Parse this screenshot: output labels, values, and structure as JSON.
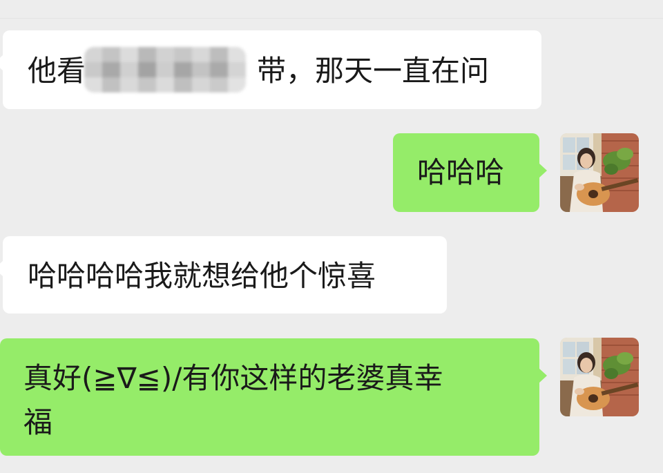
{
  "messages": [
    {
      "side": "received",
      "text_before": "他看",
      "text_after": "带，那天一直在问",
      "redacted": true
    },
    {
      "side": "sent",
      "text": "哈哈哈"
    },
    {
      "side": "received",
      "text": "哈哈哈哈我就想给他个惊喜"
    },
    {
      "side": "sent",
      "text_line1": "真好(≧∇≦)/有你这样的老婆真幸",
      "text_line2": "福"
    }
  ],
  "avatar_icon": "avatar-girl-playing-guitar-icon",
  "colors": {
    "background": "#ededed",
    "received_bubble": "#ffffff",
    "sent_bubble": "#95ec69",
    "text": "#1a1a1a"
  }
}
